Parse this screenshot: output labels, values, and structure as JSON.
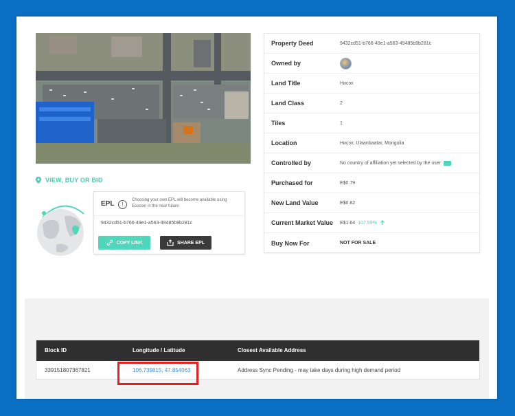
{
  "property": {
    "rows": [
      {
        "key": "Property Deed",
        "value": "9432cd51-b766-49e1-a563-49485b9b281c"
      },
      {
        "key": "Owned by",
        "value": ""
      },
      {
        "key": "Land Title",
        "value": "Нисэх"
      },
      {
        "key": "Land Class",
        "value": "2"
      },
      {
        "key": "Tiles",
        "value": "1"
      },
      {
        "key": "Location",
        "value": "Нисэх, Ulaanbaatar, Mongolia"
      },
      {
        "key": "Controlled by",
        "value": "No country of affiliation yet selected by the user"
      },
      {
        "key": "Purchased for",
        "value": "E$0.79"
      },
      {
        "key": "New Land Value",
        "value": "E$0.82"
      },
      {
        "key": "Current Market Value",
        "value": "E$1.64",
        "extra": "107.59%"
      },
      {
        "key": "Buy Now For",
        "value": "NOT FOR SALE"
      }
    ]
  },
  "left": {
    "view_buy_bid": "VIEW, BUY OR BID",
    "epl_title": "EPL",
    "epl_desc": "Choosing your own EPL will become available using Ecocoin in the near future",
    "epl_hash": "9432cd51-b766-49e1-a563-49485b9b281c",
    "copy_link": "COPY LINK",
    "share_epl": "SHARE EPL"
  },
  "table": {
    "headers": [
      "Block ID",
      "Longitude / Latitude",
      "Closest Available Address"
    ],
    "row": {
      "block_id": "339151807367821",
      "coords": "106.739815, 47.854063",
      "address": "Address Sync Pending - may take days during high demand period"
    }
  },
  "colors": {
    "background": "#0a6fc2",
    "accent": "#4fd6bb",
    "highlight": "#e41e1e"
  },
  "icons": [
    "map-pin-icon",
    "info-icon",
    "link-icon",
    "share-icon",
    "arrow-up-icon",
    "globe-icon"
  ]
}
